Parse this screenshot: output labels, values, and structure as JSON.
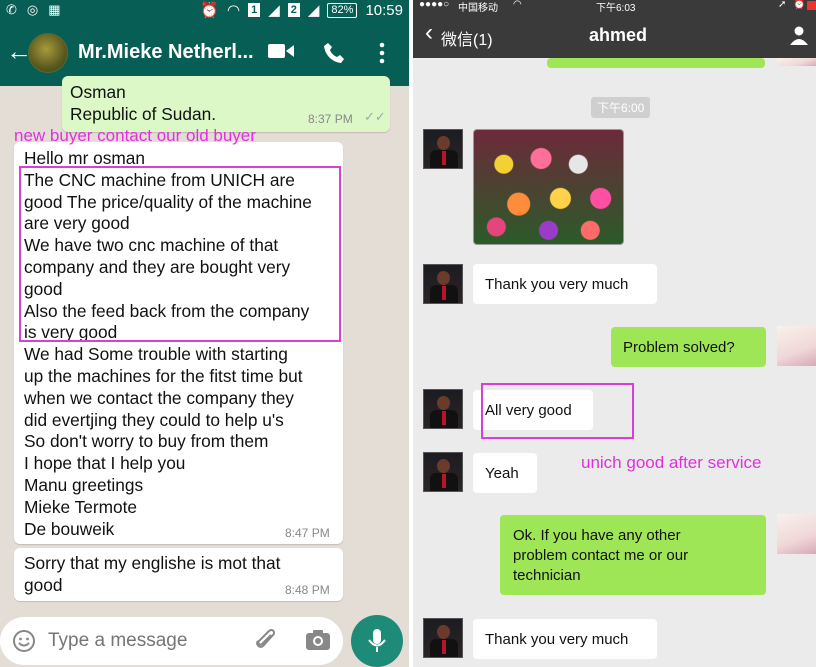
{
  "whatsapp": {
    "status_bar": {
      "sim1": "1",
      "sim2": "2",
      "battery": "82%",
      "time": "10:59"
    },
    "header": {
      "contact_name": "Mr.Mieke Netherl..."
    },
    "messages": [
      {
        "direction": "out",
        "text": "Osman\nRepublic of Sudan.",
        "time": "8:37 PM"
      },
      {
        "direction": "in",
        "text": "Hello mr osman\nThe CNC machine from UNICH are\ngood The price/quality of the machine\nare very good\nWe have two cnc machine of that\ncompany and they are bought very\ngood\nAlso the feed back from the company\nis very good\nWe had Some trouble with starting\nup the machines for the fitst time but\nwhen we contact the company they\ndid evertjing they could to help u's\nSo don't worry to buy from them\nI hope that I help you\nManu greetings\nMieke Termote\nDe bouweik",
        "time": "8:47 PM"
      },
      {
        "direction": "in",
        "text": "Sorry that my englishe is mot that\ngood",
        "time": "8:48 PM"
      }
    ],
    "annotation": "new buyer contact our old buyer",
    "input": {
      "placeholder": "Type a message"
    },
    "icons": [
      "back-arrow-icon",
      "video-call-icon",
      "phone-icon",
      "more-icon",
      "emoji-icon",
      "attach-icon",
      "camera-icon",
      "mic-icon"
    ]
  },
  "wechat": {
    "status_bar": {
      "carrier": "中国移动",
      "time": "下午6:03"
    },
    "header": {
      "back_label": "微信(1)",
      "title": "ahmed"
    },
    "timestamp": "下午6:00",
    "messages": [
      {
        "direction": "in",
        "type": "image",
        "description": "roses"
      },
      {
        "direction": "in",
        "text": "Thank you very much"
      },
      {
        "direction": "out",
        "text": "Problem solved?"
      },
      {
        "direction": "in",
        "text": "All very good"
      },
      {
        "direction": "in",
        "text": "Yeah"
      },
      {
        "direction": "out",
        "text": "Ok. If you have any other\nproblem contact me or our\ntechnician"
      },
      {
        "direction": "in",
        "text": "Thank you very much"
      }
    ],
    "annotation": "unich good after service"
  },
  "colors": {
    "whatsapp_header": "#075e54",
    "whatsapp_out_bubble": "#dcf8c6",
    "whatsapp_mic": "#1d8b77",
    "wechat_header": "#3a3a3a",
    "wechat_out_bubble": "#9fe657",
    "annotation": "#e130e0"
  }
}
